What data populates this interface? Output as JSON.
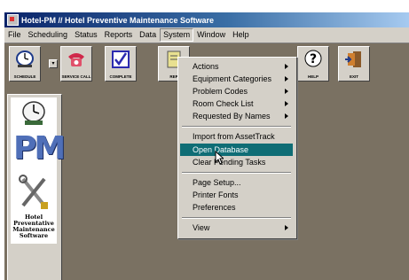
{
  "window": {
    "title": "Hotel-PM // Hotel Preventive Maintenance Software"
  },
  "menubar": {
    "items": [
      "File",
      "Scheduling",
      "Status",
      "Reports",
      "Data",
      "System",
      "Window",
      "Help"
    ],
    "active": "System"
  },
  "toolbar": {
    "buttons": [
      {
        "label": "SCHEDULE",
        "icon": "clock-icon"
      },
      {
        "label": "SERVICE CALL",
        "icon": "telephone-icon"
      },
      {
        "label": "COMPLETE",
        "icon": "checkbox-icon"
      },
      {
        "label": "REP",
        "icon": "report-icon"
      },
      {
        "label": "HELP",
        "icon": "question-icon"
      },
      {
        "label": "EXIT",
        "icon": "exit-door-icon"
      }
    ]
  },
  "logo": {
    "letters": "PM",
    "caption_line1": "Hotel",
    "caption_line2": "Preventative",
    "caption_line3": "Maintenance",
    "caption_line4": "Software"
  },
  "system_menu": {
    "group1": [
      {
        "label": "Actions",
        "submenu": true
      },
      {
        "label": "Equipment Categories",
        "submenu": true
      },
      {
        "label": "Problem Codes",
        "submenu": true
      },
      {
        "label": "Room Check List",
        "submenu": true
      },
      {
        "label": "Requested By Names",
        "submenu": true
      }
    ],
    "group2": [
      {
        "label": "Import from AssetTrack"
      },
      {
        "label": "Open Database",
        "highlighted": true
      },
      {
        "label": "Clear Pending Tasks"
      }
    ],
    "group3": [
      {
        "label": "Page Setup..."
      },
      {
        "label": "Printer Fonts"
      },
      {
        "label": "Preferences"
      }
    ],
    "group4": [
      {
        "label": "View",
        "submenu": true
      }
    ]
  },
  "colors": {
    "highlight": "#0f6d75",
    "workspace": "#7a7162",
    "chrome": "#d4d0c8",
    "titlebar_start": "#0a246a"
  }
}
